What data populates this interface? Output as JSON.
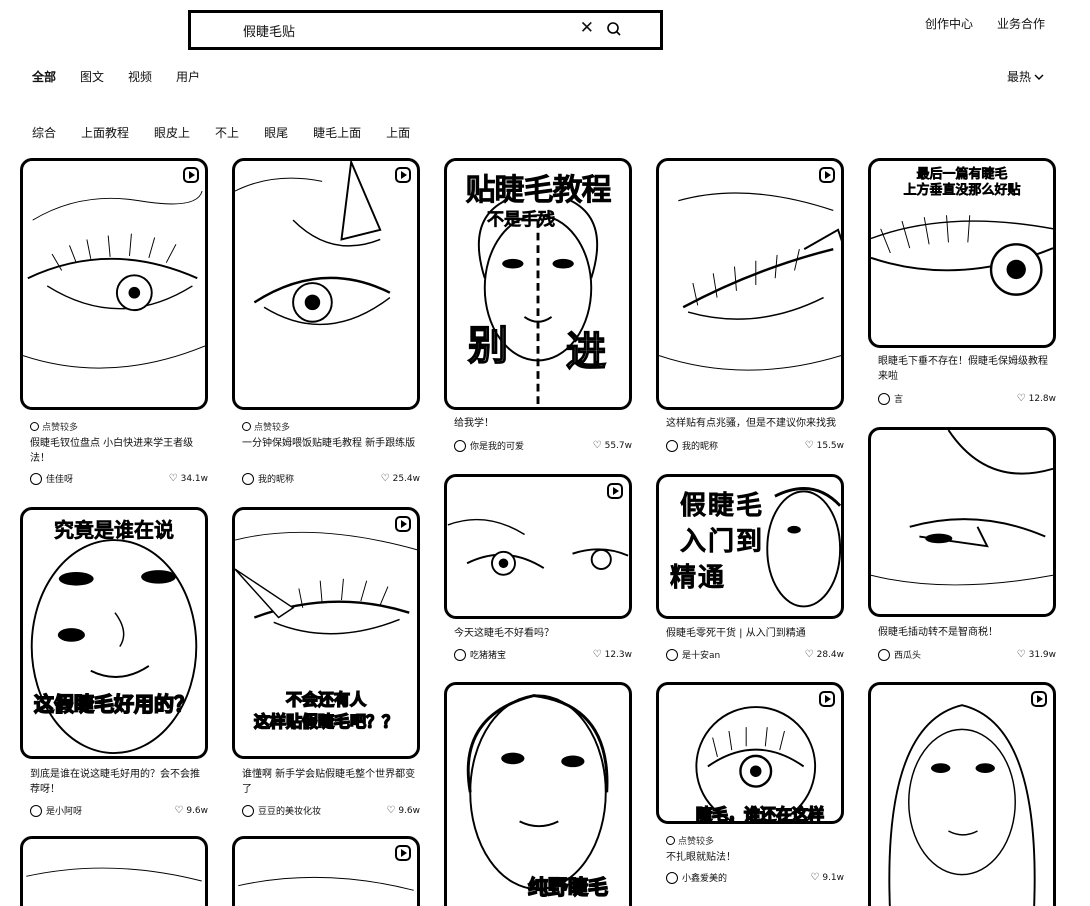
{
  "search": {
    "value": "假睫毛贴"
  },
  "header": {
    "links": [
      "创作中心",
      "业务合作"
    ]
  },
  "type_tabs": [
    "全部",
    "图文",
    "视频",
    "用户"
  ],
  "sort": {
    "label": "最热"
  },
  "chips": [
    "综合",
    "上面教程",
    "眼皮上",
    "不上",
    "眼尾",
    "睫毛上面",
    "上面"
  ],
  "cards": [
    {
      "title": "假睫毛钗位盘点 小白快进来学王者级法！",
      "tag": "点赞较多",
      "author": "佳佳呀",
      "likes": "34.1w",
      "cover_text": []
    },
    {
      "title": "一分钟保姆喂饭贴睫毛教程 新手跟练版",
      "tag": "点赞较多",
      "author": "我的昵称",
      "likes": "25.4w",
      "cover_text": []
    },
    {
      "title": "给我学！",
      "tag": "",
      "author": "你是我的可爱",
      "likes": "55.7w",
      "cover_text": [
        "贴睫毛教程",
        "不是手残",
        "别",
        "进"
      ]
    },
    {
      "title": "这样贴有点兆骚，但是不建议你来找我",
      "tag": "",
      "author": "我的昵称",
      "likes": "15.5w",
      "cover_text": []
    },
    {
      "title": "眼睫毛下垂不存在！假睫毛保姆级教程来啦",
      "tag": "",
      "author": "言",
      "likes": "12.8w",
      "cover_text": [
        "最后一篇有睫毛",
        "上方垂直没那么好贴"
      ]
    },
    {
      "title": "到底是谁在说这睫毛好用的？会不会推荐呀！",
      "tag": "",
      "author": "是小阿呀",
      "likes": "9.6w",
      "cover_text": [
        "究竟是谁在说",
        "这假睫毛好用的？"
      ]
    },
    {
      "title": "谁懂啊 新手学会贴假睫毛整个世界都变了",
      "tag": "",
      "author": "豆豆的美妆化妆",
      "likes": "9.6w",
      "cover_text": [
        "不会还有人",
        "这样贴假睫毛吧？？"
      ]
    },
    {
      "title": "今天这睫毛不好看吗？",
      "tag": "",
      "author": "吃猪猪宝",
      "likes": "12.3w",
      "cover_text": []
    },
    {
      "title": "假睫毛零死干货 | 从入门到精通",
      "tag": "",
      "author": "是十安an",
      "likes": "28.4w",
      "cover_text": [
        "假",
        "睫",
        "毛",
        "入",
        "门",
        "到",
        "精",
        "通"
      ]
    },
    {
      "title": "假睫毛插动转不是智商税！",
      "tag": "",
      "author": "西瓜头",
      "likes": "31.9w",
      "cover_text": []
    },
    {
      "title": "",
      "tag": "",
      "author": "",
      "likes": "",
      "cover_text": [
        "纯野睫毛"
      ]
    },
    {
      "title": "不扎眼就贴法！",
      "tag": "点赞较多",
      "author": "小鑫爱美的",
      "likes": "9.1w",
      "cover_text": [
        "睫毛，谁还在这样"
      ]
    },
    {
      "title": "",
      "tag": "",
      "author": "",
      "likes": "",
      "cover_text": []
    },
    {
      "title": "",
      "tag": "",
      "author": "",
      "likes": "",
      "cover_text": []
    },
    {
      "title": "",
      "tag": "",
      "author": "",
      "likes": "",
      "cover_text": []
    }
  ]
}
